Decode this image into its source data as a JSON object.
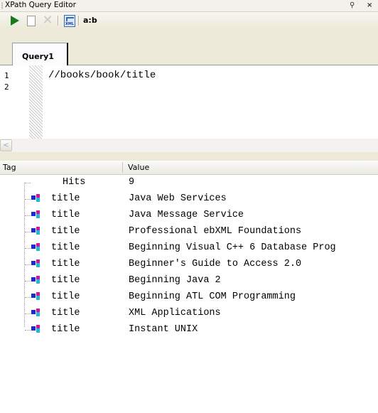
{
  "window": {
    "title": "XPath Query Editor",
    "pin_glyph": "⚲",
    "close_glyph": "×"
  },
  "toolbar": {
    "buttons": [
      {
        "name": "run-query",
        "icon": "play-icon"
      },
      {
        "name": "new-query",
        "icon": "new-document-icon"
      },
      {
        "name": "delete-query",
        "icon": "delete-icon",
        "glyph": "✕"
      },
      {
        "name": "xml-source",
        "icon": "xml-icon",
        "icon_text": "XML"
      }
    ],
    "namespace_label": "a:b"
  },
  "tabs": [
    {
      "label": "Query1",
      "active": true
    }
  ],
  "editor": {
    "line_numbers": [
      "1",
      "2"
    ],
    "lines": [
      "//books/book/title"
    ]
  },
  "scrollbar": {
    "left_arrow_glyph": "<"
  },
  "results": {
    "columns": [
      "Tag",
      "Value"
    ],
    "hits": {
      "tag": "Hits",
      "value": "9"
    },
    "rows": [
      {
        "tag": "title",
        "value": "Java Web Services"
      },
      {
        "tag": "title",
        "value": "Java Message Service"
      },
      {
        "tag": "title",
        "value": "Professional ebXML Foundations"
      },
      {
        "tag": "title",
        "value": "Beginning Visual C++ 6 Database Prog"
      },
      {
        "tag": "title",
        "value": "Beginner's Guide to Access 2.0"
      },
      {
        "tag": "title",
        "value": "Beginning Java 2"
      },
      {
        "tag": "title",
        "value": "Beginning ATL COM Programming"
      },
      {
        "tag": "title",
        "value": "XML Applications"
      },
      {
        "tag": "title",
        "value": "Instant UNIX"
      }
    ]
  },
  "colors": {
    "run_icon": "#1a7a1a",
    "element_icon_blue": "#1a2bd6",
    "element_icon_magenta": "#d8139b",
    "element_icon_cyan": "#20b8d2",
    "chrome": "#ece9d8"
  }
}
